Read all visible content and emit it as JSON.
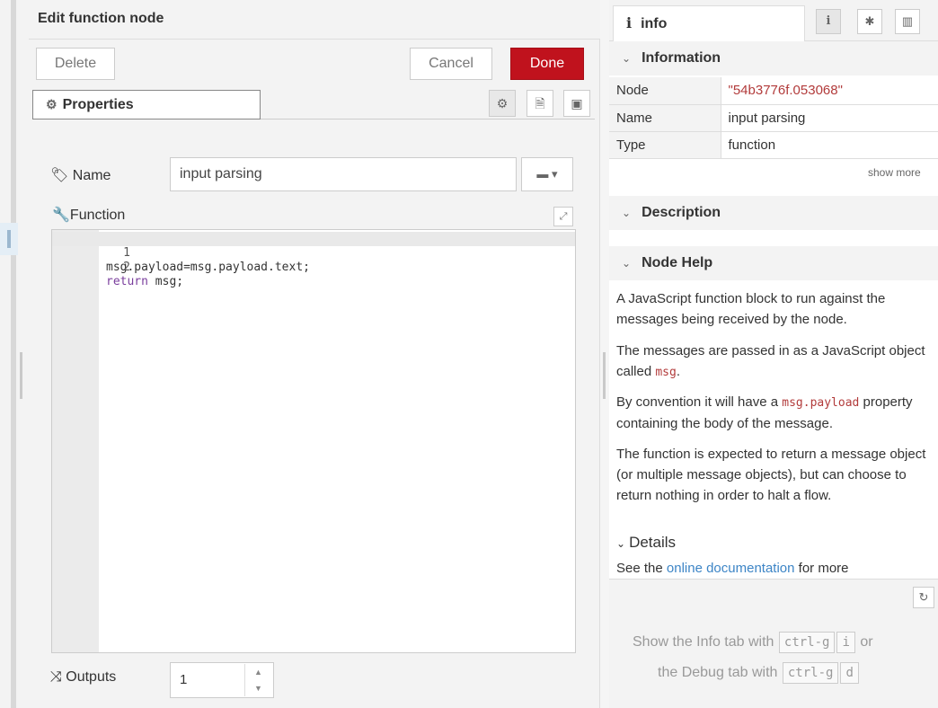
{
  "tray": {
    "title": "Edit function node",
    "delete_label": "Delete",
    "cancel_label": "Cancel",
    "done_label": "Done",
    "tab_properties": "Properties",
    "tab_properties_icon": "gear-icon",
    "tab_icons": [
      "gear-icon",
      "description-icon",
      "appearance-icon"
    ]
  },
  "form": {
    "name_label": "Name",
    "name_value": "input parsing",
    "function_label": "Function",
    "outputs_label": "Outputs",
    "outputs_value": "1"
  },
  "editor": {
    "lines": [
      {
        "num": "1",
        "text": "msg.payload=msg.payload.text;"
      },
      {
        "num": "2",
        "keyword": "return",
        "text": " msg;"
      }
    ]
  },
  "sidebar": {
    "tab_label": "info",
    "tab_icon": "i",
    "information_header": "Information",
    "info_rows": [
      {
        "key": "Node",
        "value": "\"54b3776f.053068\""
      },
      {
        "key": "Name",
        "value": "input parsing"
      },
      {
        "key": "Type",
        "value": "function"
      }
    ],
    "show_more": "show more",
    "description_header": "Description",
    "node_help_header": "Node Help",
    "help": {
      "p1": "A JavaScript function block to run against the messages being received by the node.",
      "p2_a": "The messages are passed in as a JavaScript object called ",
      "p2_code": "msg",
      "p2_b": ".",
      "p3_a": "By convention it will have a ",
      "p3_code": "msg.payload",
      "p3_b": " property containing the body of the message.",
      "p4": "The function is expected to return a message object (or multiple message objects), but can choose to return nothing in order to halt a flow.",
      "details_label": "Details",
      "see_a": "See the ",
      "see_link": "online documentation",
      "see_b": " for more"
    },
    "footer": {
      "hint1_a": "Show the Info tab with",
      "hint1_key": "ctrl-g",
      "hint1_key2": "i",
      "hint1_b": "or",
      "hint2_a": "the Debug tab with",
      "hint2_key": "ctrl-g",
      "hint2_key2": "d"
    }
  },
  "colors": {
    "done_button": "#c0121d",
    "link": "#3d85c6",
    "code_red": "#b23b3b",
    "keyword": "#7a3e9d"
  }
}
